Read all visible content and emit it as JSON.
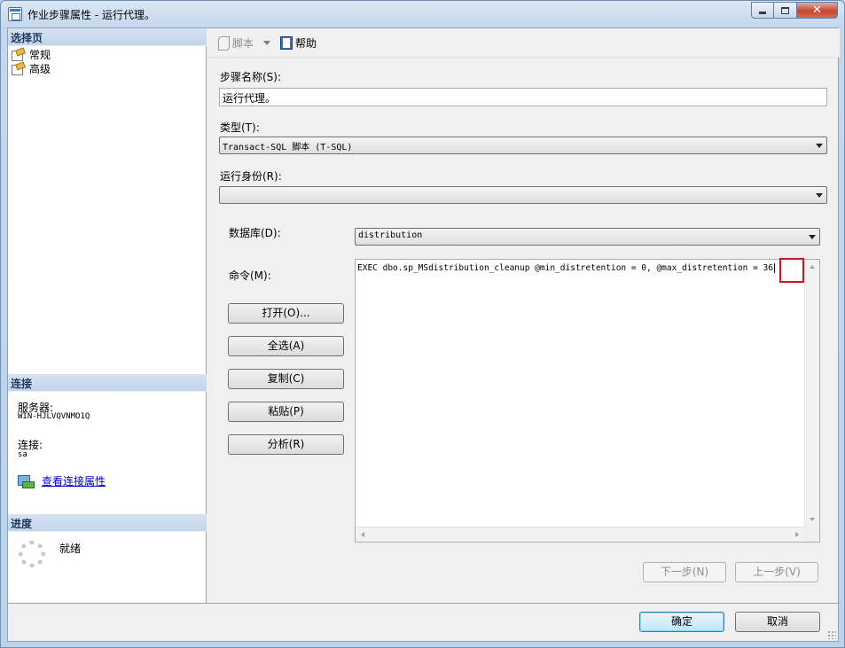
{
  "window": {
    "title": "作业步骤属性 - 运行代理。"
  },
  "left_pane": {
    "select_page_header": "选择页",
    "pages": [
      {
        "label": "常规"
      },
      {
        "label": "高级"
      }
    ],
    "connection_header": "连接",
    "server_label": "服务器:",
    "server_value": "WIN-HJLVQVNMO1Q",
    "connection_label": "连接:",
    "connection_value": "sa",
    "view_connection_link": "查看连接属性",
    "progress_header": "进度",
    "progress_status": "就绪"
  },
  "toolbar": {
    "script_label": "脚本",
    "help_label": "帮助"
  },
  "form": {
    "step_name_label": "步骤名称(S):",
    "step_name_value": "运行代理。",
    "type_label": "类型(T):",
    "type_value": "Transact-SQL 脚本 (T-SQL)",
    "run_as_label": "运行身份(R):",
    "run_as_value": "",
    "database_label": "数据库(D):",
    "database_value": "distribution",
    "command_label": "命令(M):",
    "command_text": "EXEC dbo.sp_MSdistribution_cleanup @min_distretention = 0, @max_distretention = 36"
  },
  "command_buttons": {
    "open": "打开(O)...",
    "select_all": "全选(A)",
    "copy": "复制(C)",
    "paste": "粘贴(P)",
    "parse": "分析(R)"
  },
  "nav_buttons": {
    "next": "下一步(N)",
    "previous": "上一步(V)"
  },
  "dialog_buttons": {
    "ok": "确定",
    "cancel": "取消"
  },
  "colors": {
    "highlight_box": "#d0151b",
    "link": "#0000cc",
    "section_header_bg": "#c3d6ec"
  }
}
